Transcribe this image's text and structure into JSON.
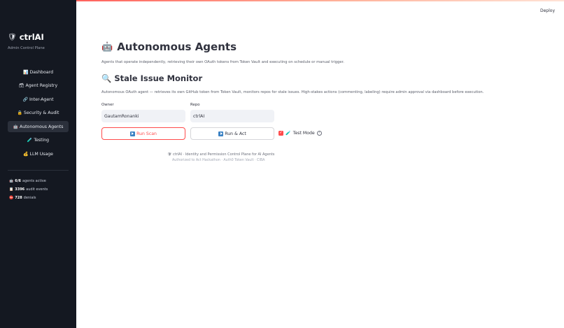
{
  "header": {
    "deploy_label": "Deploy"
  },
  "sidebar": {
    "brand": {
      "icon": "shield-icon",
      "title": "ctrlAI",
      "subtitle": "Admin Control Plane"
    },
    "items": [
      {
        "icon": "📊",
        "icon_name": "chart-icon",
        "label": "Dashboard",
        "active": false
      },
      {
        "icon": "🗃",
        "icon_name": "registry-icon",
        "label": "Agent Registry",
        "active": false
      },
      {
        "icon": "🔗",
        "icon_name": "link-icon",
        "label": "Inter-Agent",
        "active": false
      },
      {
        "icon": "🔒",
        "icon_name": "lock-icon",
        "label": "Security & Audit",
        "active": false
      },
      {
        "icon": "🤖",
        "icon_name": "robot-icon",
        "label": "Autonomous Agents",
        "active": true
      },
      {
        "icon": "🧪",
        "icon_name": "flask-icon",
        "label": "Testing",
        "active": false
      },
      {
        "icon": "💰",
        "icon_name": "money-bag-icon",
        "label": "LLM Usage",
        "active": false
      }
    ],
    "stats": [
      {
        "icon": "🤖",
        "value": "6/6",
        "label": "agents active"
      },
      {
        "icon": "📋",
        "value": "3396",
        "label": "audit events"
      },
      {
        "icon": "⛔",
        "value": "728",
        "label": "denials"
      }
    ]
  },
  "main": {
    "title": "Autonomous Agents",
    "title_icon": "🤖",
    "description": "Agents that operate independently, retrieving their own OAuth tokens from Token Vault and executing on schedule or manual trigger.",
    "section": {
      "title": "Stale Issue Monitor",
      "icon": "🔍",
      "description": "Autonomous OAuth agent — retrieves its own GitHub token from Token Vault, monitors repos for stale issues. High-stakes actions (commenting, labeling) require admin approval via dashboard before execution.",
      "owner_label": "Owner",
      "owner_value": "GautamRonanki",
      "repo_label": "Repo",
      "repo_value": "ctrlAI",
      "run_scan_label": "Run Scan",
      "run_act_label": "Run & Act",
      "test_mode_label": "Test Mode",
      "test_mode_checked": true,
      "help_glyph": "?"
    }
  },
  "footer": {
    "line1": "ctrlAI · Identity and Permission Control Plane for AI Agents",
    "line2": "Authorized to Act Hackathon · Auth0 Token Vault · CIBA"
  },
  "colors": {
    "accent": "#ff4b4b",
    "sidebar_bg": "#141821",
    "input_bg": "#f0f2f6"
  }
}
